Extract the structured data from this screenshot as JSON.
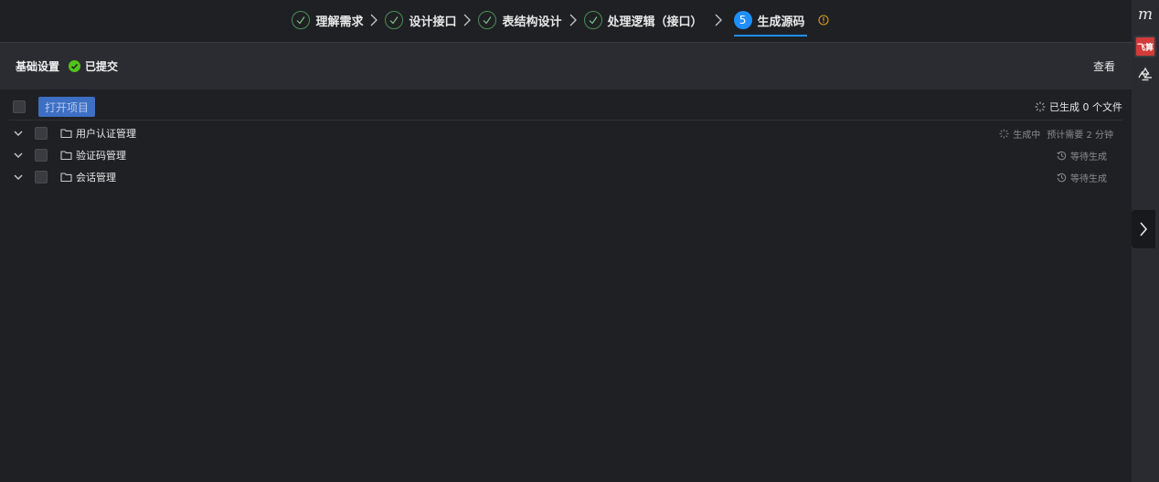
{
  "steps": [
    {
      "label": "理解需求",
      "state": "done"
    },
    {
      "label": "设计接口",
      "state": "done"
    },
    {
      "label": "表结构设计",
      "state": "done"
    },
    {
      "label": "处理逻辑（接口）",
      "state": "done"
    },
    {
      "label": "生成源码",
      "state": "active",
      "number": "5"
    }
  ],
  "settings": {
    "title": "基础设置",
    "status": "已提交",
    "view_label": "查看"
  },
  "toolbar": {
    "open_project_label": "打开项目",
    "generated_count": "已生成 0 个文件"
  },
  "tree": [
    {
      "label": "用户认证管理",
      "status": "生成中",
      "eta": "预计需要 2 分钟",
      "state": "generating"
    },
    {
      "label": "验证码管理",
      "status": "等待生成",
      "state": "waiting"
    },
    {
      "label": "会话管理",
      "status": "等待生成",
      "state": "waiting"
    }
  ],
  "rail": {
    "logo_letter": "m",
    "badge_text": "飞算"
  },
  "colors": {
    "accent": "#1f8fff",
    "success": "#52c41a",
    "warning": "#d4a017",
    "badge": "#d33b3b"
  },
  "icons": [
    "check-icon",
    "chevron-right-icon",
    "info-icon",
    "check-circle-icon",
    "loading-icon",
    "chevron-down-icon",
    "folder-icon",
    "history-icon",
    "flower-icon"
  ]
}
